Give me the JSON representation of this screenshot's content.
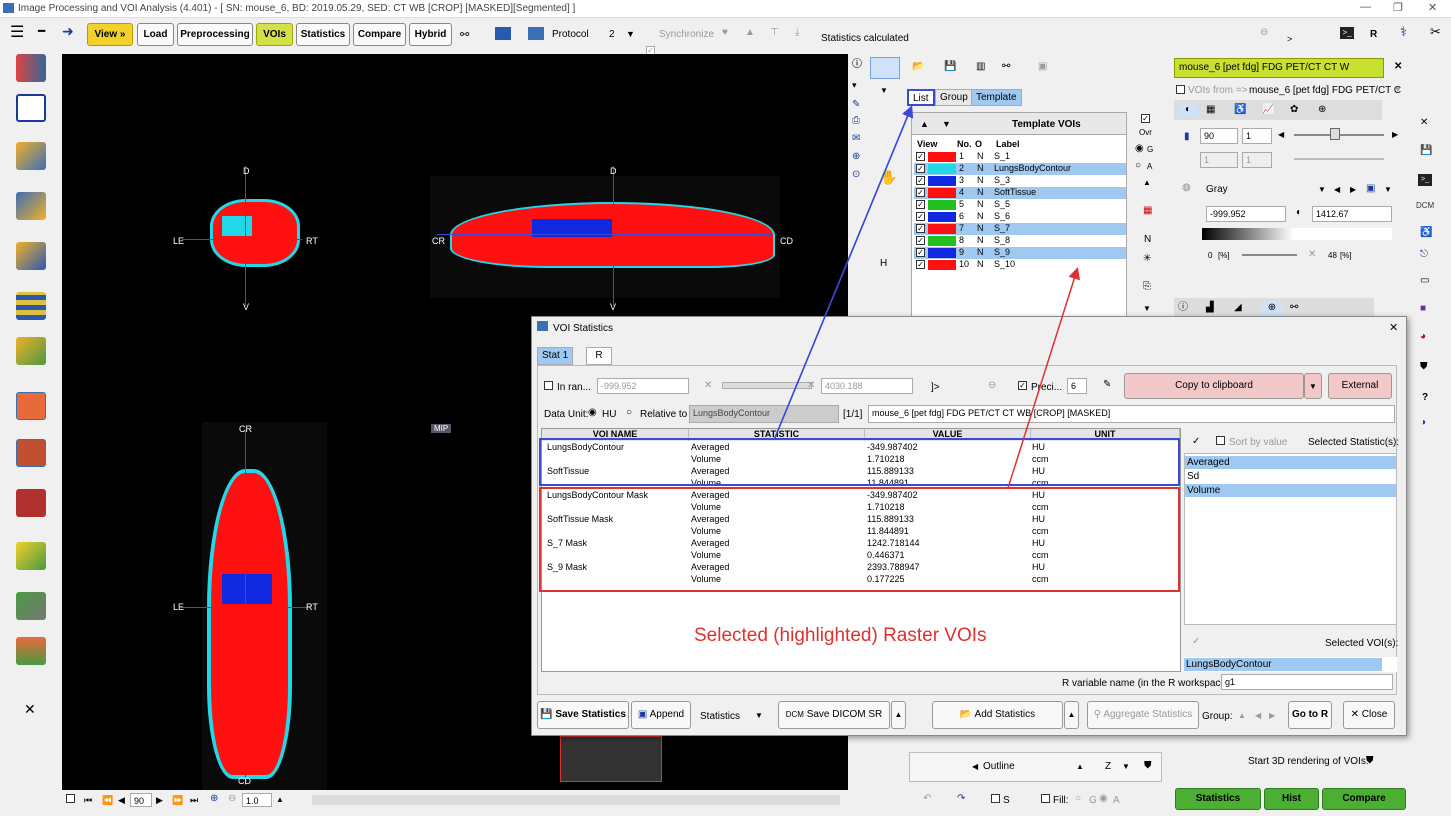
{
  "window": {
    "title": "Image Processing and VOI Analysis (4.401) - [ SN: mouse_6, BD: 2019.05.29, SED: CT WB [CROP] [MASKED][Segmented] ]"
  },
  "toolbar": {
    "view": "View »",
    "load": "Load",
    "preprocessing": "Preprocessing",
    "vois": "VOIs",
    "statistics": "Statistics",
    "compare": "Compare",
    "hybrid": "Hybrid",
    "protocol": "Protocol",
    "layout_num": "2",
    "synchronize": "Synchronize",
    "status": "Statistics calculated",
    "r": "R"
  },
  "viewer": {
    "d1": "D",
    "le1": "LE",
    "rt1": "RT",
    "v1": "V",
    "d2": "D",
    "cr1": "CR",
    "cd1": "CD",
    "v2": "V",
    "cr2": "CR",
    "le2": "LE",
    "rt2": "RT",
    "cd2": "CD",
    "mip": "MIP",
    "slice": "90",
    "zoom": "1.0"
  },
  "colors": {
    "red": "#ff1010",
    "blue": "#1028e0",
    "cyan": "#22d8e8",
    "green": "#20c020",
    "highlight": "#9fc9f0",
    "accent_yellow": "#f2d12a"
  },
  "voi_panel": {
    "tabs": [
      "List",
      "Group",
      "Template"
    ],
    "header": "Template VOIs",
    "cols": [
      "View",
      "No.",
      "O",
      "Label"
    ],
    "rows": [
      {
        "no": "1",
        "o": "N",
        "label": "S_1",
        "color": "#ff1010",
        "sel": false
      },
      {
        "no": "2",
        "o": "N",
        "label": "LungsBodyContour",
        "color": "#22d8e8",
        "sel": true
      },
      {
        "no": "3",
        "o": "N",
        "label": "S_3",
        "color": "#1028e0",
        "sel": false
      },
      {
        "no": "4",
        "o": "N",
        "label": "SoftTissue",
        "color": "#ff1010",
        "sel": true
      },
      {
        "no": "5",
        "o": "N",
        "label": "S_5",
        "color": "#20c020",
        "sel": false
      },
      {
        "no": "6",
        "o": "N",
        "label": "S_6",
        "color": "#1028e0",
        "sel": false
      },
      {
        "no": "7",
        "o": "N",
        "label": "S_7",
        "color": "#ff1010",
        "sel": true
      },
      {
        "no": "8",
        "o": "N",
        "label": "S_8",
        "color": "#20c020",
        "sel": false
      },
      {
        "no": "9",
        "o": "N",
        "label": "S_9",
        "color": "#1028e0",
        "sel": true
      },
      {
        "no": "10",
        "o": "N",
        "label": "S_10",
        "color": "#ff1010",
        "sel": false
      }
    ],
    "ovr": "Ovr",
    "g": "G",
    "a": "A",
    "n": "N",
    "h": "H",
    "outline": "Outline",
    "z": "Z",
    "s": "S",
    "fill": "Fill:",
    "fill_g": "G",
    "fill_a": "A"
  },
  "right": {
    "series": "mouse_6 [pet fdg] FDG PET/CT CT W",
    "vois_from": "VOIs from =>",
    "vois_from_val": "mouse_6 [pet fdg] FDG PET/CT C",
    "slice": "90",
    "step": "1",
    "slice2": "1",
    "step2": "1",
    "colormap": "Gray",
    "min": "-999.952",
    "max": "1412.67",
    "pct_lo": "0",
    "pct_unit": "[%]",
    "pct_hi": "48",
    "render3d": "Start 3D rendering of VOIs:",
    "statistics": "Statistics",
    "hist": "Hist",
    "compare": "Compare",
    "dcm": "DCM",
    "q": "?"
  },
  "dialog": {
    "title": "VOI Statistics",
    "tabs": [
      "Stat 1",
      "R"
    ],
    "in_range": "In ran...",
    "range_lo": "-999.952",
    "range_hi": "4030.188",
    "gt": "]> ",
    "preci": "Preci...",
    "preci_val": "6",
    "copy": "Copy to clipboard",
    "external": "External",
    "data_unit": "Data Unit:",
    "hu": "HU",
    "relative": "Relative to",
    "rel_val": "LungsBodyContour",
    "paging": "[1/1]",
    "series": "mouse_6 [pet fdg] FDG PET/CT CT WB [CROP] [MASKED]",
    "cols": [
      "VOI NAME",
      "STATISTIC",
      "VALUE",
      "UNIT"
    ],
    "rows": [
      [
        "LungsBodyContour",
        "Averaged",
        "-349.987402",
        "HU"
      ],
      [
        "",
        "Volume",
        "1.710218",
        "ccm"
      ],
      [
        "SoftTissue",
        "Averaged",
        "115.889133",
        "HU"
      ],
      [
        "",
        "Volume",
        "11.844891",
        "ccm"
      ],
      [
        "LungsBodyContour Mask",
        "Averaged",
        "-349.987402",
        "HU"
      ],
      [
        "",
        "Volume",
        "1.710218",
        "ccm"
      ],
      [
        "SoftTissue Mask",
        "Averaged",
        "115.889133",
        "HU"
      ],
      [
        "",
        "Volume",
        "11.844891",
        "ccm"
      ],
      [
        "S_7 Mask",
        "Averaged",
        "1242.718144",
        "HU"
      ],
      [
        "",
        "Volume",
        "0.446371",
        "ccm"
      ],
      [
        "S_9 Mask",
        "Averaged",
        "2393.788947",
        "HU"
      ],
      [
        "",
        "Volume",
        "0.177225",
        "ccm"
      ]
    ],
    "annotation": "Selected (highlighted) Raster VOIs",
    "sort_by_value": "Sort by value",
    "selected_stats": "Selected Statistic(s):",
    "stats": [
      "Averaged",
      "Sd",
      "Volume"
    ],
    "selected_vois": "Selected VOI(s):",
    "voi_sel": "LungsBodyContour",
    "r_var": "R variable name (in the R workspace)",
    "r_var_val": "g1",
    "save_stats": "Save Statistics",
    "append": "Append",
    "stat_menu": "Statistics",
    "dcm": "DCM",
    "save_dicom": "Save DICOM SR",
    "add_stats": "Add Statistics",
    "agg": "Aggregate Statistics",
    "group": "Group:",
    "go_r": "Go to R",
    "close": "Close"
  }
}
